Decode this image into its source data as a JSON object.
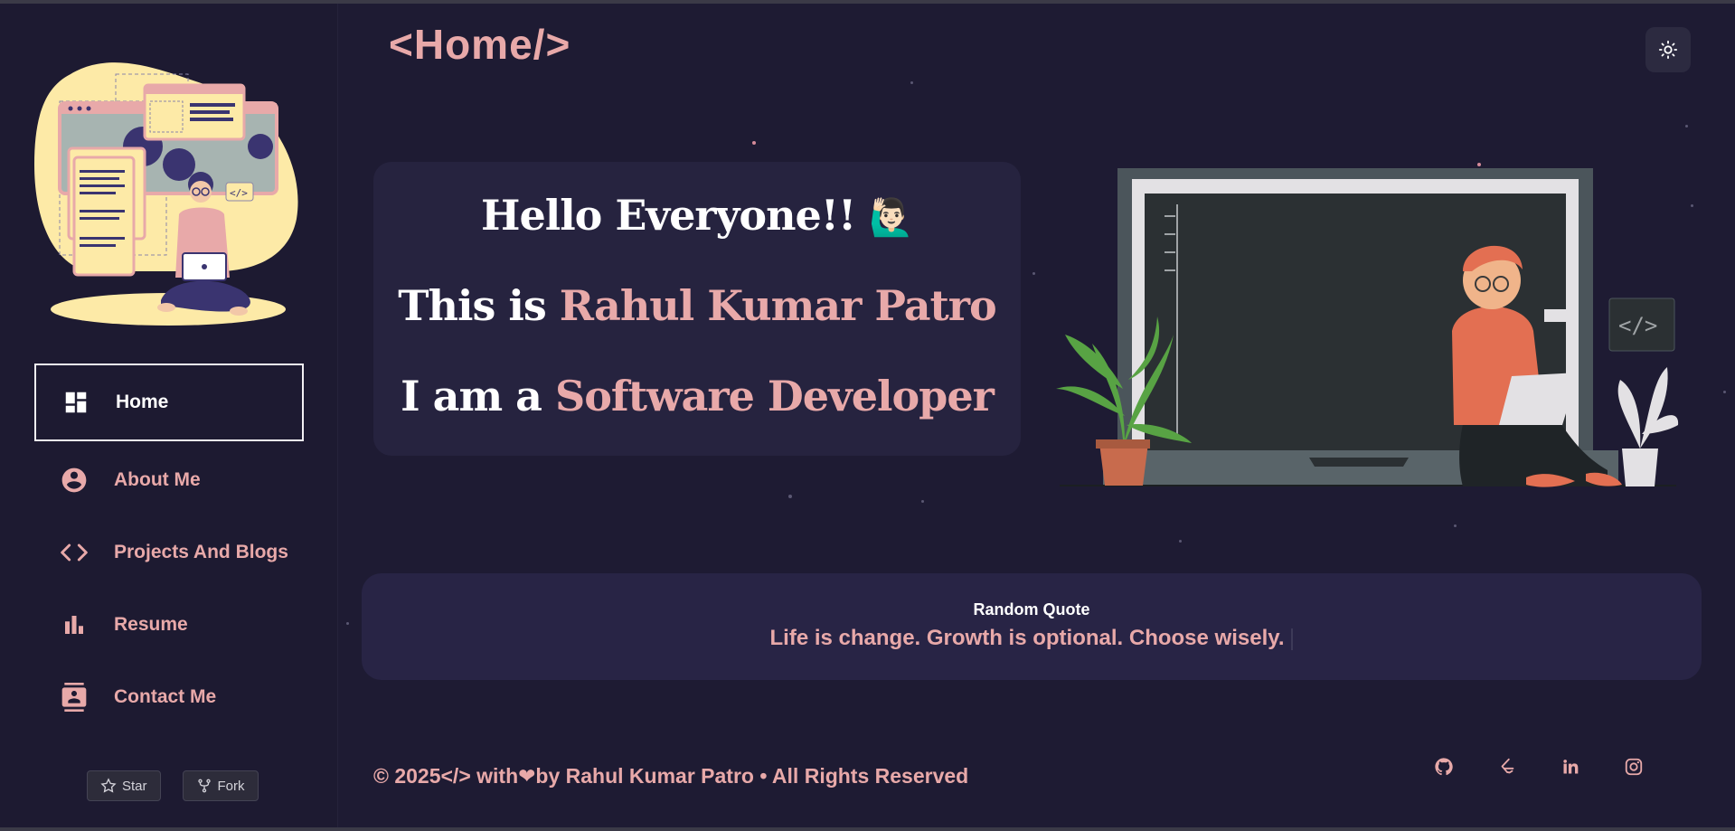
{
  "header": {
    "title": "<Home/>"
  },
  "theme_toggle": {
    "icon": "sun-icon"
  },
  "sidebar": {
    "items": [
      {
        "label": "Home",
        "icon": "dashboard-icon",
        "active": true
      },
      {
        "label": "About Me",
        "icon": "account-circle-icon",
        "active": false
      },
      {
        "label": "Projects And Blogs",
        "icon": "code-icon",
        "active": false
      },
      {
        "label": "Resume",
        "icon": "bar-chart-icon",
        "active": false
      },
      {
        "label": "Contact Me",
        "icon": "contact-card-icon",
        "active": false
      }
    ],
    "github": {
      "star_label": "Star",
      "fork_label": "Fork"
    }
  },
  "hero": {
    "line1": "Hello Everyone!!",
    "line1_emoji": "🙋🏻‍♂️",
    "line2_prefix": "This is ",
    "name": "Rahul Kumar Patro",
    "line3_prefix": "I am a ",
    "role": "Software Developer"
  },
  "quote": {
    "title": "Random Quote",
    "text": "Life is change. Growth is optional. Choose wisely."
  },
  "footer": {
    "text": "© 2025</> with❤by Rahul Kumar Patro • All Rights Reserved",
    "socials": [
      "github-icon",
      "leetcode-icon",
      "linkedin-icon",
      "instagram-icon"
    ]
  },
  "colors": {
    "background": "#1e1b33",
    "card": "#26233f",
    "accent": "#e8a9a9",
    "text": "#ffffff"
  }
}
